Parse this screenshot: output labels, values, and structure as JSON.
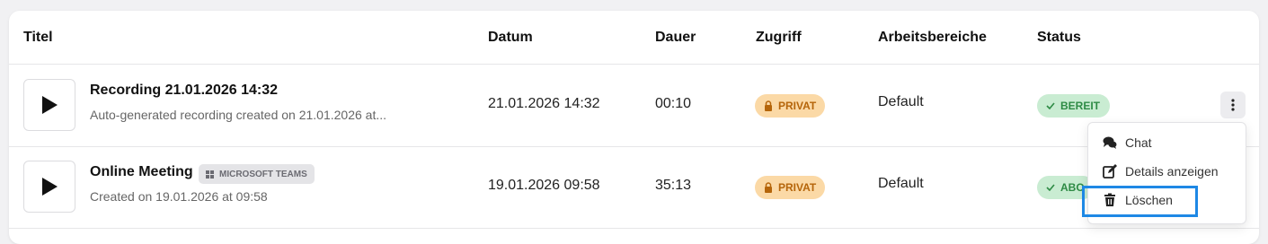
{
  "columns": {
    "title": "Titel",
    "date": "Datum",
    "duration": "Dauer",
    "access": "Zugriff",
    "workspaces": "Arbeitsbereiche",
    "status": "Status"
  },
  "rows": [
    {
      "title": "Recording 21.01.2026 14:32",
      "subtitle": "Auto-generated recording created on 21.01.2026 at...",
      "date": "21.01.2026 14:32",
      "duration": "00:10",
      "access": "PRIVAT",
      "workspace": "Default",
      "status": "BEREIT"
    },
    {
      "title": "Online Meeting",
      "source_badge": "MICROSOFT TEAMS",
      "subtitle": "Created on 19.01.2026 at 09:58",
      "date": "19.01.2026 09:58",
      "duration": "35:13",
      "access": "PRIVAT",
      "workspace": "Default",
      "status": "ABO"
    }
  ],
  "context_menu": {
    "items": [
      "Chat",
      "Details anzeigen",
      "Löschen"
    ]
  },
  "colors": {
    "access_badge_bg": "#fbd9a6",
    "access_badge_fg": "#b5650a",
    "status_badge_bg": "#c9ecd2",
    "status_badge_fg": "#2e8b45",
    "focus_outline": "#1e88e5"
  },
  "icons": {
    "thumbnail": "play-icon",
    "access": "lock-icon",
    "status": "check-icon",
    "source": "windows-icon",
    "row_menu": "kebab-icon",
    "menu_chat": "chat-icon",
    "menu_details": "edit-icon",
    "menu_delete": "trash-icon"
  }
}
